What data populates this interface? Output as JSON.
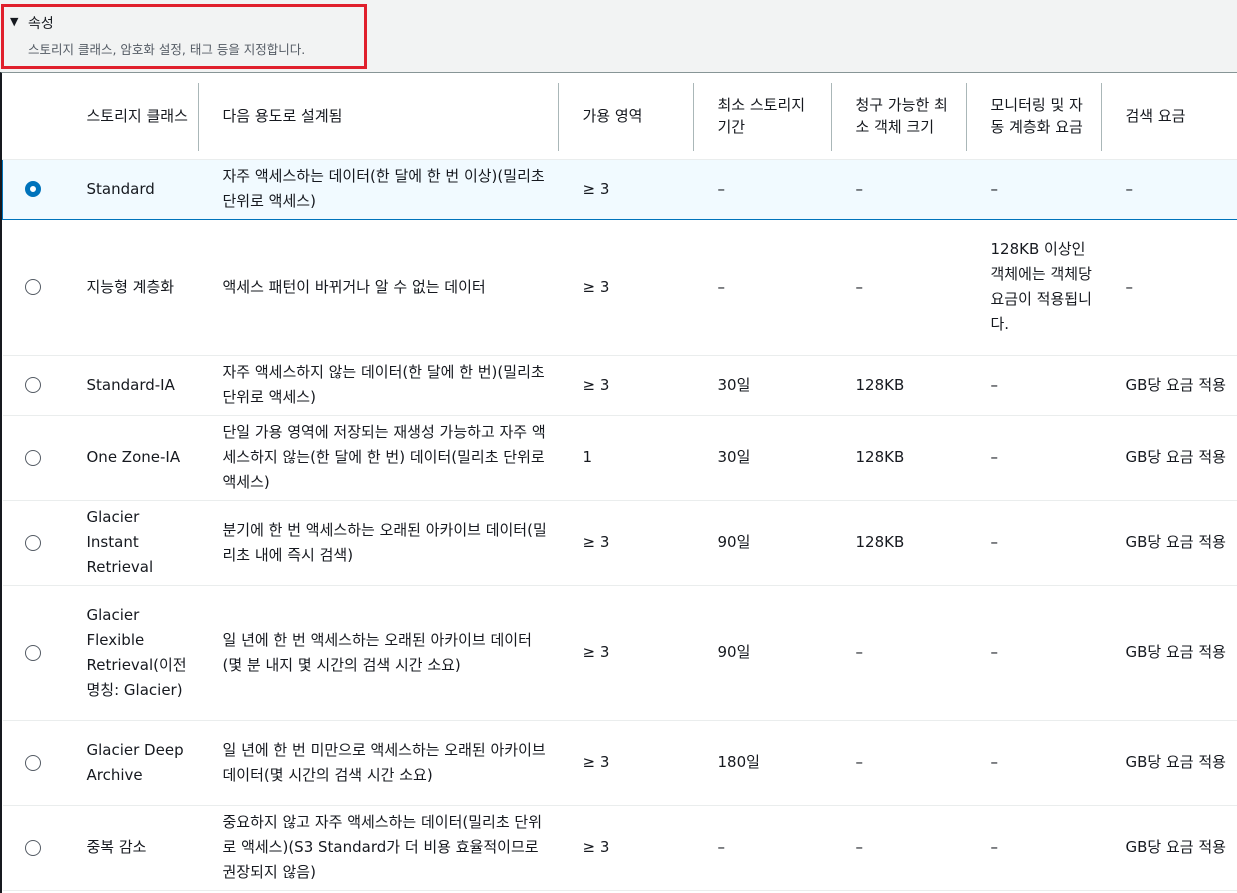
{
  "section": {
    "toggle_icon": "caret-down",
    "title": "속성",
    "description": "스토리지 클래스, 암호화 설정, 태그 등을 지정합니다."
  },
  "colors": {
    "selected_accent": "#0073bb",
    "highlight_border": "#e0202c"
  },
  "table": {
    "headers": [
      "",
      "스토리지 클래스",
      "다음 용도로 설계됨",
      "가용 영역",
      "최소 스토리지 기간",
      "청구 가능한 최소 객체 크기",
      "모니터링 및 자동 계층화 요금",
      "검색 요금"
    ],
    "rows": [
      {
        "selected": true,
        "cells": [
          "Standard",
          "자주 액세스하는 데이터(한 달에 한 번 이상)(밀리초 단위로 액세스)",
          "≥ 3",
          "–",
          "–",
          "–",
          "–"
        ]
      },
      {
        "selected": false,
        "cells": [
          "지능형 계층화",
          "액세스 패턴이 바뀌거나 알 수 없는 데이터",
          "≥ 3",
          "–",
          "–",
          "128KB 이상인 객체에는 객체당 요금이 적용됩니다.",
          "–"
        ]
      },
      {
        "selected": false,
        "cells": [
          "Standard-IA",
          "자주 액세스하지 않는 데이터(한 달에 한 번)(밀리초 단위로 액세스)",
          "≥ 3",
          "30일",
          "128KB",
          "–",
          "GB당 요금 적용"
        ]
      },
      {
        "selected": false,
        "cells": [
          "One Zone-IA",
          "단일 가용 영역에 저장되는 재생성 가능하고 자주 액세스하지 않는(한 달에 한 번) 데이터(밀리초 단위로 액세스)",
          "1",
          "30일",
          "128KB",
          "–",
          "GB당 요금 적용"
        ]
      },
      {
        "selected": false,
        "cells": [
          "Glacier Instant Retrieval",
          "분기에 한 번 액세스하는 오래된 아카이브 데이터(밀리초 내에 즉시 검색)",
          "≥ 3",
          "90일",
          "128KB",
          "–",
          "GB당 요금 적용"
        ]
      },
      {
        "selected": false,
        "cells": [
          "Glacier Flexible Retrieval(이전 명칭: Glacier)",
          "일 년에 한 번 액세스하는 오래된 아카이브 데이터(몇 분 내지 몇 시간의 검색 시간 소요)",
          "≥ 3",
          "90일",
          "–",
          "–",
          "GB당 요금 적용"
        ]
      },
      {
        "selected": false,
        "cells": [
          "Glacier Deep Archive",
          "일 년에 한 번 미만으로 액세스하는 오래된 아카이브 데이터(몇 시간의 검색 시간 소요)",
          "≥ 3",
          "180일",
          "–",
          "–",
          "GB당 요금 적용"
        ]
      },
      {
        "selected": false,
        "cells": [
          "중복 감소",
          "중요하지 않고 자주 액세스하는 데이터(밀리초 단위로 액세스)(S3 Standard가 더 비용 효율적이므로 권장되지 않음)",
          "≥ 3",
          "–",
          "–",
          "–",
          "GB당 요금 적용"
        ]
      }
    ]
  }
}
